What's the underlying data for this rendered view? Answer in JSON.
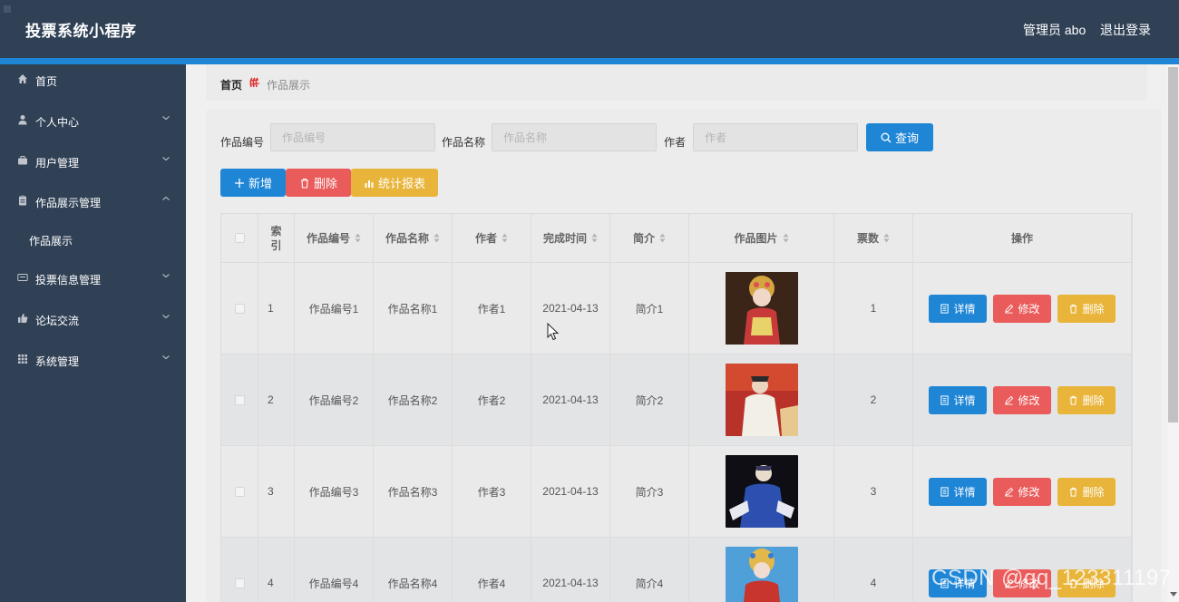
{
  "app": {
    "title": "投票系统小程序"
  },
  "header": {
    "admin": "管理员 abo",
    "logout": "退出登录"
  },
  "sidebar": {
    "items": [
      {
        "label": "首页",
        "icon": "home-icon",
        "chevron": ""
      },
      {
        "label": "个人中心",
        "icon": "user-icon",
        "chevron": "down"
      },
      {
        "label": "用户管理",
        "icon": "briefcase-icon",
        "chevron": "down"
      },
      {
        "label": "作品展示管理",
        "icon": "clipboard-icon",
        "chevron": "up"
      },
      {
        "label": "作品展示",
        "icon": "",
        "chevron": ""
      },
      {
        "label": "投票信息管理",
        "icon": "ticket-icon",
        "chevron": "down"
      },
      {
        "label": "论坛交流",
        "icon": "thumbs-up-icon",
        "chevron": "down"
      },
      {
        "label": "系统管理",
        "icon": "grid-icon",
        "chevron": "down"
      }
    ]
  },
  "breadcrumb": {
    "home": "首页",
    "current": "作品展示"
  },
  "search": {
    "code_label": "作品编号",
    "code_placeholder": "作品编号",
    "name_label": "作品名称",
    "name_placeholder": "作品名称",
    "author_label": "作者",
    "author_placeholder": "作者",
    "query": "查询"
  },
  "actions": {
    "add": "新增",
    "delete": "删除",
    "report": "统计报表"
  },
  "table": {
    "headers": [
      "索引",
      "作品编号",
      "作品名称",
      "作者",
      "完成时间",
      "简介",
      "作品图片",
      "票数",
      "操作"
    ],
    "rows": [
      {
        "index": "1",
        "code": "作品编号1",
        "name": "作品名称1",
        "author": "作者1",
        "date": "2021-04-13",
        "intro": "简介1",
        "votes": "1"
      },
      {
        "index": "2",
        "code": "作品编号2",
        "name": "作品名称2",
        "author": "作者2",
        "date": "2021-04-13",
        "intro": "简介2",
        "votes": "2"
      },
      {
        "index": "3",
        "code": "作品编号3",
        "name": "作品名称3",
        "author": "作者3",
        "date": "2021-04-13",
        "intro": "简介3",
        "votes": "3"
      },
      {
        "index": "4",
        "code": "作品编号4",
        "name": "作品名称4",
        "author": "作者4",
        "date": "2021-04-13",
        "intro": "简介4",
        "votes": "4"
      }
    ],
    "row_actions": {
      "detail": "详情",
      "edit": "修改",
      "delete": "删除"
    }
  },
  "watermark": "CSDN @qq_123311197",
  "colors": {
    "topbar": "#304156",
    "accent": "#1f86d6",
    "danger": "#ea5b5b",
    "warning": "#e8b43a"
  }
}
